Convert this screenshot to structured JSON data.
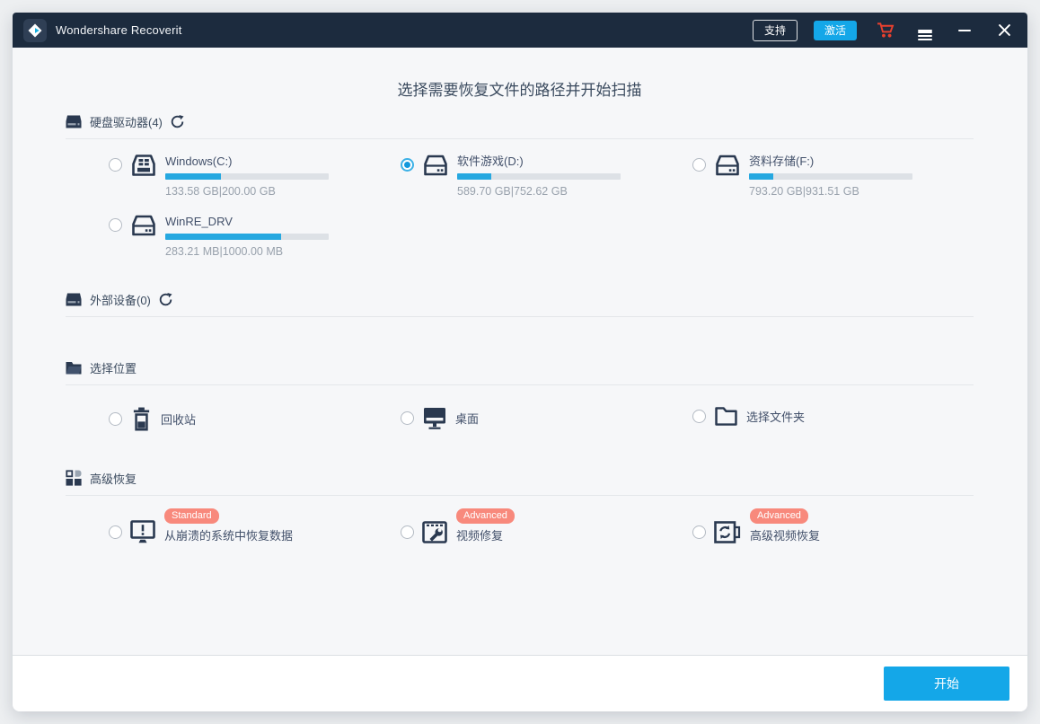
{
  "titlebar": {
    "app_title": "Wondershare Recoverit",
    "support_label": "支持",
    "activate_label": "激活"
  },
  "heading": "选择需要恢复文件的路径并开始扫描",
  "sections": {
    "hard_drives_title": "硬盘驱动器(4)",
    "external_title": "外部设备(0)",
    "location_title": "选择位置",
    "advanced_title": "高级恢复"
  },
  "drives": [
    {
      "name": "Windows(C:)",
      "size": "133.58 GB|200.00 GB",
      "used_pct": 34,
      "selected": false
    },
    {
      "name": "软件游戏(D:)",
      "size": "589.70 GB|752.62 GB",
      "used_pct": 21,
      "selected": true
    },
    {
      "name": "资料存储(F:)",
      "size": "793.20 GB|931.51 GB",
      "used_pct": 15,
      "selected": false
    },
    {
      "name": "WinRE_DRV",
      "size": "283.21 MB|1000.00 MB",
      "used_pct": 71,
      "selected": false
    }
  ],
  "locations": [
    {
      "label": "回收站"
    },
    {
      "label": "桌面"
    },
    {
      "label": "选择文件夹"
    }
  ],
  "advanced": [
    {
      "badge": "Standard",
      "label": "从崩溃的系统中恢复数据"
    },
    {
      "badge": "Advanced",
      "label": "视频修复"
    },
    {
      "badge": "Advanced",
      "label": "高级视频恢复"
    }
  ],
  "footer": {
    "start_label": "开始"
  },
  "colors": {
    "titlebar_bg": "#1c2b3e",
    "accent_blue": "#14a7e8",
    "progress_fill": "#26a8e0",
    "progress_track": "#dde1e6",
    "badge_bg": "#f8897c",
    "cart_red": "#e8402e",
    "icon_dark": "#2a3950"
  }
}
